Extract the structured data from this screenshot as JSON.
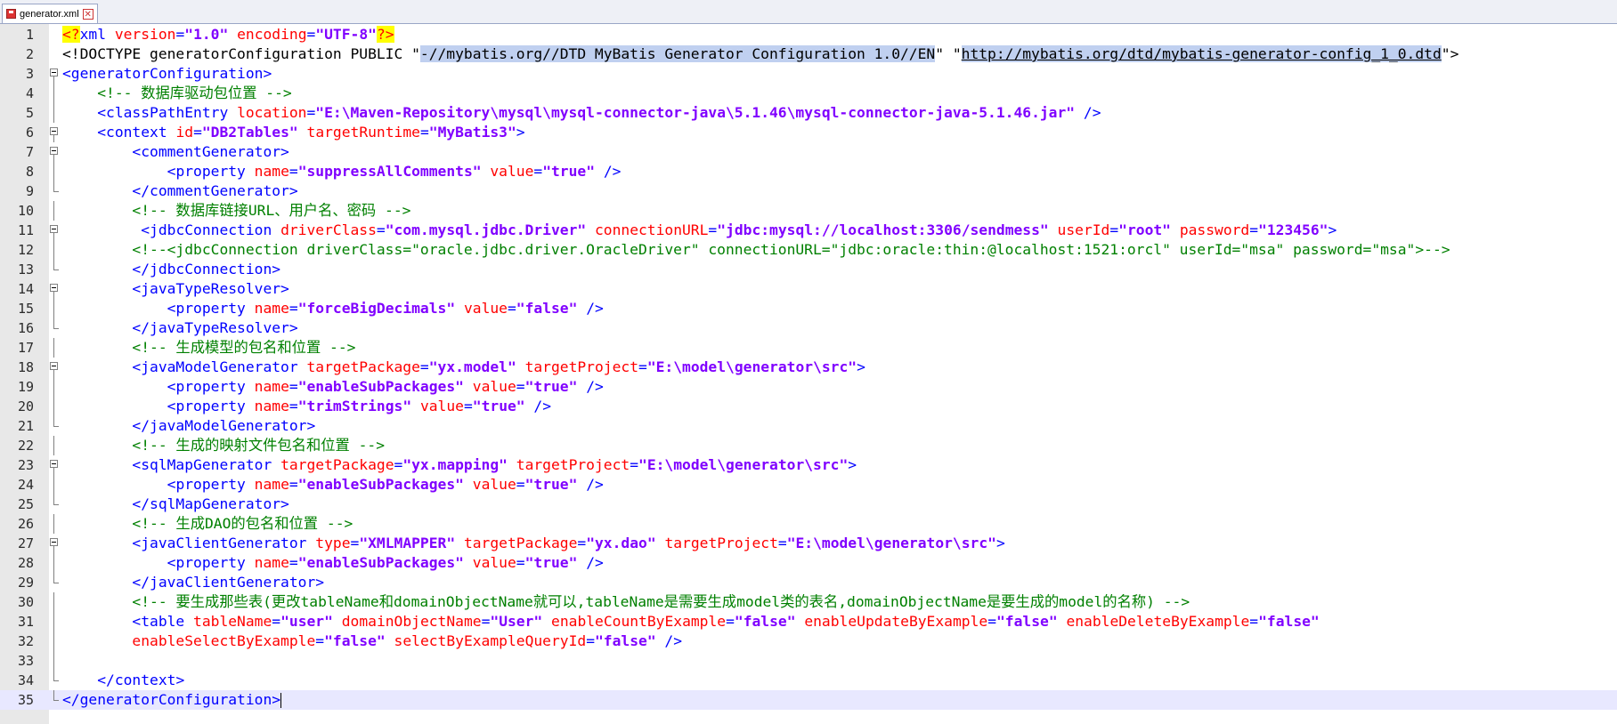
{
  "tab": {
    "title": "generator.xml",
    "close_glyph": "✕"
  },
  "editor": {
    "current_line": 35,
    "lines": [
      {
        "n": "1",
        "fold": "none",
        "segs": [
          {
            "t": "<?",
            "c": "c-pi"
          },
          {
            "t": "xml ",
            "c": "c-pi-word"
          },
          {
            "t": "version",
            "c": "c-attr"
          },
          {
            "t": "=",
            "c": "c-tag"
          },
          {
            "t": "\"1.0\"",
            "c": "c-val"
          },
          {
            "t": " ",
            "c": ""
          },
          {
            "t": "encoding",
            "c": "c-attr"
          },
          {
            "t": "=",
            "c": "c-tag"
          },
          {
            "t": "\"UTF-8\"",
            "c": "c-val"
          },
          {
            "t": "?>",
            "c": "c-pi"
          }
        ]
      },
      {
        "n": "2",
        "fold": "none",
        "segs": [
          {
            "t": "<!DOCTYPE generatorConfiguration PUBLIC \"",
            "c": "c-doct"
          },
          {
            "t": "-//mybatis.org//DTD MyBatis Generator Configuration 1.0//EN",
            "c": "c-sel"
          },
          {
            "t": "\" \"",
            "c": "c-doct"
          },
          {
            "t": "http://mybatis.org/dtd/mybatis-generator-config_1_0.dtd",
            "c": "c-url"
          },
          {
            "t": "\">",
            "c": "c-doct"
          }
        ]
      },
      {
        "n": "3",
        "fold": "open",
        "segs": [
          {
            "t": "<generatorConfiguration>",
            "c": "c-tag"
          }
        ]
      },
      {
        "n": "4",
        "fold": "line",
        "segs": [
          {
            "t": "    ",
            "c": ""
          },
          {
            "t": "<!-- 数据库驱动包位置 -->",
            "c": "c-cmt"
          }
        ]
      },
      {
        "n": "5",
        "fold": "line",
        "segs": [
          {
            "t": "    ",
            "c": ""
          },
          {
            "t": "<classPathEntry ",
            "c": "c-tag"
          },
          {
            "t": "location",
            "c": "c-attr"
          },
          {
            "t": "=",
            "c": "c-tag"
          },
          {
            "t": "\"E:\\Maven-Repository\\mysql\\mysql-connector-java\\5.1.46\\mysql-connector-java-5.1.46.jar\"",
            "c": "c-val"
          },
          {
            "t": " />",
            "c": "c-tag"
          }
        ]
      },
      {
        "n": "6",
        "fold": "open",
        "segs": [
          {
            "t": "    ",
            "c": ""
          },
          {
            "t": "<context ",
            "c": "c-tag"
          },
          {
            "t": "id",
            "c": "c-attr"
          },
          {
            "t": "=",
            "c": "c-tag"
          },
          {
            "t": "\"DB2Tables\"",
            "c": "c-val"
          },
          {
            "t": " ",
            "c": ""
          },
          {
            "t": "targetRuntime",
            "c": "c-attr"
          },
          {
            "t": "=",
            "c": "c-tag"
          },
          {
            "t": "\"MyBatis3\"",
            "c": "c-val"
          },
          {
            "t": ">",
            "c": "c-tag"
          }
        ]
      },
      {
        "n": "7",
        "fold": "open",
        "segs": [
          {
            "t": "        ",
            "c": ""
          },
          {
            "t": "<commentGenerator>",
            "c": "c-tag"
          }
        ]
      },
      {
        "n": "8",
        "fold": "line",
        "segs": [
          {
            "t": "            ",
            "c": ""
          },
          {
            "t": "<property ",
            "c": "c-tag"
          },
          {
            "t": "name",
            "c": "c-attr"
          },
          {
            "t": "=",
            "c": "c-tag"
          },
          {
            "t": "\"suppressAllComments\"",
            "c": "c-val"
          },
          {
            "t": " ",
            "c": ""
          },
          {
            "t": "value",
            "c": "c-attr"
          },
          {
            "t": "=",
            "c": "c-tag"
          },
          {
            "t": "\"true\"",
            "c": "c-val"
          },
          {
            "t": " />",
            "c": "c-tag"
          }
        ]
      },
      {
        "n": "9",
        "fold": "end",
        "segs": [
          {
            "t": "        ",
            "c": ""
          },
          {
            "t": "</commentGenerator>",
            "c": "c-tag"
          }
        ]
      },
      {
        "n": "10",
        "fold": "line",
        "segs": [
          {
            "t": "        ",
            "c": ""
          },
          {
            "t": "<!-- 数据库链接URL、用户名、密码 -->",
            "c": "c-cmt"
          }
        ]
      },
      {
        "n": "11",
        "fold": "open",
        "segs": [
          {
            "t": "         ",
            "c": ""
          },
          {
            "t": "<jdbcConnection ",
            "c": "c-tag"
          },
          {
            "t": "driverClass",
            "c": "c-attr"
          },
          {
            "t": "=",
            "c": "c-tag"
          },
          {
            "t": "\"com.mysql.jdbc.Driver\"",
            "c": "c-val"
          },
          {
            "t": " ",
            "c": ""
          },
          {
            "t": "connectionURL",
            "c": "c-attr"
          },
          {
            "t": "=",
            "c": "c-tag"
          },
          {
            "t": "\"jdbc:mysql://localhost:3306/sendmess\"",
            "c": "c-val"
          },
          {
            "t": " ",
            "c": ""
          },
          {
            "t": "userId",
            "c": "c-attr"
          },
          {
            "t": "=",
            "c": "c-tag"
          },
          {
            "t": "\"root\"",
            "c": "c-val"
          },
          {
            "t": " ",
            "c": ""
          },
          {
            "t": "password",
            "c": "c-attr"
          },
          {
            "t": "=",
            "c": "c-tag"
          },
          {
            "t": "\"123456\"",
            "c": "c-val"
          },
          {
            "t": ">",
            "c": "c-tag"
          }
        ]
      },
      {
        "n": "12",
        "fold": "line",
        "segs": [
          {
            "t": "        ",
            "c": ""
          },
          {
            "t": "<!--<jdbcConnection driverClass=\"oracle.jdbc.driver.OracleDriver\" connectionURL=\"jdbc:oracle:thin:@localhost:1521:orcl\" userId=\"msa\" password=\"msa\">-->",
            "c": "c-cmt"
          }
        ]
      },
      {
        "n": "13",
        "fold": "end",
        "segs": [
          {
            "t": "        ",
            "c": ""
          },
          {
            "t": "</jdbcConnection>",
            "c": "c-tag"
          }
        ]
      },
      {
        "n": "14",
        "fold": "open",
        "segs": [
          {
            "t": "        ",
            "c": ""
          },
          {
            "t": "<javaTypeResolver>",
            "c": "c-tag"
          }
        ]
      },
      {
        "n": "15",
        "fold": "line",
        "segs": [
          {
            "t": "            ",
            "c": ""
          },
          {
            "t": "<property ",
            "c": "c-tag"
          },
          {
            "t": "name",
            "c": "c-attr"
          },
          {
            "t": "=",
            "c": "c-tag"
          },
          {
            "t": "\"forceBigDecimals\"",
            "c": "c-val"
          },
          {
            "t": " ",
            "c": ""
          },
          {
            "t": "value",
            "c": "c-attr"
          },
          {
            "t": "=",
            "c": "c-tag"
          },
          {
            "t": "\"false\"",
            "c": "c-val"
          },
          {
            "t": " />",
            "c": "c-tag"
          }
        ]
      },
      {
        "n": "16",
        "fold": "end",
        "segs": [
          {
            "t": "        ",
            "c": ""
          },
          {
            "t": "</javaTypeResolver>",
            "c": "c-tag"
          }
        ]
      },
      {
        "n": "17",
        "fold": "line",
        "segs": [
          {
            "t": "        ",
            "c": ""
          },
          {
            "t": "<!-- 生成模型的包名和位置 -->",
            "c": "c-cmt"
          }
        ]
      },
      {
        "n": "18",
        "fold": "open",
        "segs": [
          {
            "t": "        ",
            "c": ""
          },
          {
            "t": "<javaModelGenerator ",
            "c": "c-tag"
          },
          {
            "t": "targetPackage",
            "c": "c-attr"
          },
          {
            "t": "=",
            "c": "c-tag"
          },
          {
            "t": "\"yx.model\"",
            "c": "c-val"
          },
          {
            "t": " ",
            "c": ""
          },
          {
            "t": "targetProject",
            "c": "c-attr"
          },
          {
            "t": "=",
            "c": "c-tag"
          },
          {
            "t": "\"E:\\model\\generator\\src\"",
            "c": "c-val"
          },
          {
            "t": ">",
            "c": "c-tag"
          }
        ]
      },
      {
        "n": "19",
        "fold": "line",
        "segs": [
          {
            "t": "            ",
            "c": ""
          },
          {
            "t": "<property ",
            "c": "c-tag"
          },
          {
            "t": "name",
            "c": "c-attr"
          },
          {
            "t": "=",
            "c": "c-tag"
          },
          {
            "t": "\"enableSubPackages\"",
            "c": "c-val"
          },
          {
            "t": " ",
            "c": ""
          },
          {
            "t": "value",
            "c": "c-attr"
          },
          {
            "t": "=",
            "c": "c-tag"
          },
          {
            "t": "\"true\"",
            "c": "c-val"
          },
          {
            "t": " />",
            "c": "c-tag"
          }
        ]
      },
      {
        "n": "20",
        "fold": "line",
        "segs": [
          {
            "t": "            ",
            "c": ""
          },
          {
            "t": "<property ",
            "c": "c-tag"
          },
          {
            "t": "name",
            "c": "c-attr"
          },
          {
            "t": "=",
            "c": "c-tag"
          },
          {
            "t": "\"trimStrings\"",
            "c": "c-val"
          },
          {
            "t": " ",
            "c": ""
          },
          {
            "t": "value",
            "c": "c-attr"
          },
          {
            "t": "=",
            "c": "c-tag"
          },
          {
            "t": "\"true\"",
            "c": "c-val"
          },
          {
            "t": " />",
            "c": "c-tag"
          }
        ]
      },
      {
        "n": "21",
        "fold": "end",
        "segs": [
          {
            "t": "        ",
            "c": ""
          },
          {
            "t": "</javaModelGenerator>",
            "c": "c-tag"
          }
        ]
      },
      {
        "n": "22",
        "fold": "line",
        "segs": [
          {
            "t": "        ",
            "c": ""
          },
          {
            "t": "<!-- 生成的映射文件包名和位置 -->",
            "c": "c-cmt"
          }
        ]
      },
      {
        "n": "23",
        "fold": "open",
        "segs": [
          {
            "t": "        ",
            "c": ""
          },
          {
            "t": "<sqlMapGenerator ",
            "c": "c-tag"
          },
          {
            "t": "targetPackage",
            "c": "c-attr"
          },
          {
            "t": "=",
            "c": "c-tag"
          },
          {
            "t": "\"yx.mapping\"",
            "c": "c-val"
          },
          {
            "t": " ",
            "c": ""
          },
          {
            "t": "targetProject",
            "c": "c-attr"
          },
          {
            "t": "=",
            "c": "c-tag"
          },
          {
            "t": "\"E:\\model\\generator\\src\"",
            "c": "c-val"
          },
          {
            "t": ">",
            "c": "c-tag"
          }
        ]
      },
      {
        "n": "24",
        "fold": "line",
        "segs": [
          {
            "t": "            ",
            "c": ""
          },
          {
            "t": "<property ",
            "c": "c-tag"
          },
          {
            "t": "name",
            "c": "c-attr"
          },
          {
            "t": "=",
            "c": "c-tag"
          },
          {
            "t": "\"enableSubPackages\"",
            "c": "c-val"
          },
          {
            "t": " ",
            "c": ""
          },
          {
            "t": "value",
            "c": "c-attr"
          },
          {
            "t": "=",
            "c": "c-tag"
          },
          {
            "t": "\"true\"",
            "c": "c-val"
          },
          {
            "t": " />",
            "c": "c-tag"
          }
        ]
      },
      {
        "n": "25",
        "fold": "end",
        "segs": [
          {
            "t": "        ",
            "c": ""
          },
          {
            "t": "</sqlMapGenerator>",
            "c": "c-tag"
          }
        ]
      },
      {
        "n": "26",
        "fold": "line",
        "segs": [
          {
            "t": "        ",
            "c": ""
          },
          {
            "t": "<!-- 生成DAO的包名和位置 -->",
            "c": "c-cmt"
          }
        ]
      },
      {
        "n": "27",
        "fold": "open",
        "segs": [
          {
            "t": "        ",
            "c": ""
          },
          {
            "t": "<javaClientGenerator ",
            "c": "c-tag"
          },
          {
            "t": "type",
            "c": "c-attr"
          },
          {
            "t": "=",
            "c": "c-tag"
          },
          {
            "t": "\"XMLMAPPER\"",
            "c": "c-val"
          },
          {
            "t": " ",
            "c": ""
          },
          {
            "t": "targetPackage",
            "c": "c-attr"
          },
          {
            "t": "=",
            "c": "c-tag"
          },
          {
            "t": "\"yx.dao\"",
            "c": "c-val"
          },
          {
            "t": " ",
            "c": ""
          },
          {
            "t": "targetProject",
            "c": "c-attr"
          },
          {
            "t": "=",
            "c": "c-tag"
          },
          {
            "t": "\"E:\\model\\generator\\src\"",
            "c": "c-val"
          },
          {
            "t": ">",
            "c": "c-tag"
          }
        ]
      },
      {
        "n": "28",
        "fold": "line",
        "segs": [
          {
            "t": "            ",
            "c": ""
          },
          {
            "t": "<property ",
            "c": "c-tag"
          },
          {
            "t": "name",
            "c": "c-attr"
          },
          {
            "t": "=",
            "c": "c-tag"
          },
          {
            "t": "\"enableSubPackages\"",
            "c": "c-val"
          },
          {
            "t": " ",
            "c": ""
          },
          {
            "t": "value",
            "c": "c-attr"
          },
          {
            "t": "=",
            "c": "c-tag"
          },
          {
            "t": "\"true\"",
            "c": "c-val"
          },
          {
            "t": " />",
            "c": "c-tag"
          }
        ]
      },
      {
        "n": "29",
        "fold": "end",
        "segs": [
          {
            "t": "        ",
            "c": ""
          },
          {
            "t": "</javaClientGenerator>",
            "c": "c-tag"
          }
        ]
      },
      {
        "n": "30",
        "fold": "line",
        "segs": [
          {
            "t": "        ",
            "c": ""
          },
          {
            "t": "<!-- 要生成那些表(更改tableName和domainObjectName就可以,tableName是需要生成model类的表名,domainObjectName是要生成的model的名称) -->",
            "c": "c-cmt"
          }
        ]
      },
      {
        "n": "31",
        "fold": "line",
        "segs": [
          {
            "t": "        ",
            "c": ""
          },
          {
            "t": "<table ",
            "c": "c-tag"
          },
          {
            "t": "tableName",
            "c": "c-attr"
          },
          {
            "t": "=",
            "c": "c-tag"
          },
          {
            "t": "\"user\"",
            "c": "c-val"
          },
          {
            "t": " ",
            "c": ""
          },
          {
            "t": "domainObjectName",
            "c": "c-attr"
          },
          {
            "t": "=",
            "c": "c-tag"
          },
          {
            "t": "\"User\"",
            "c": "c-val"
          },
          {
            "t": " ",
            "c": ""
          },
          {
            "t": "enableCountByExample",
            "c": "c-attr"
          },
          {
            "t": "=",
            "c": "c-tag"
          },
          {
            "t": "\"false\"",
            "c": "c-val"
          },
          {
            "t": " ",
            "c": ""
          },
          {
            "t": "enableUpdateByExample",
            "c": "c-attr"
          },
          {
            "t": "=",
            "c": "c-tag"
          },
          {
            "t": "\"false\"",
            "c": "c-val"
          },
          {
            "t": " ",
            "c": ""
          },
          {
            "t": "enableDeleteByExample",
            "c": "c-attr"
          },
          {
            "t": "=",
            "c": "c-tag"
          },
          {
            "t": "\"false\"",
            "c": "c-val"
          }
        ]
      },
      {
        "n": "32",
        "fold": "line",
        "segs": [
          {
            "t": "        ",
            "c": ""
          },
          {
            "t": "enableSelectByExample",
            "c": "c-attr"
          },
          {
            "t": "=",
            "c": "c-tag"
          },
          {
            "t": "\"false\"",
            "c": "c-val"
          },
          {
            "t": " ",
            "c": ""
          },
          {
            "t": "selectByExampleQueryId",
            "c": "c-attr"
          },
          {
            "t": "=",
            "c": "c-tag"
          },
          {
            "t": "\"false\"",
            "c": "c-val"
          },
          {
            "t": " />",
            "c": "c-tag"
          }
        ]
      },
      {
        "n": "33",
        "fold": "line",
        "segs": []
      },
      {
        "n": "34",
        "fold": "end",
        "segs": [
          {
            "t": "    ",
            "c": ""
          },
          {
            "t": "</context>",
            "c": "c-tag"
          }
        ]
      },
      {
        "n": "35",
        "fold": "end",
        "segs": [
          {
            "t": "</generatorConfiguration>",
            "c": "c-tag"
          }
        ]
      }
    ]
  }
}
